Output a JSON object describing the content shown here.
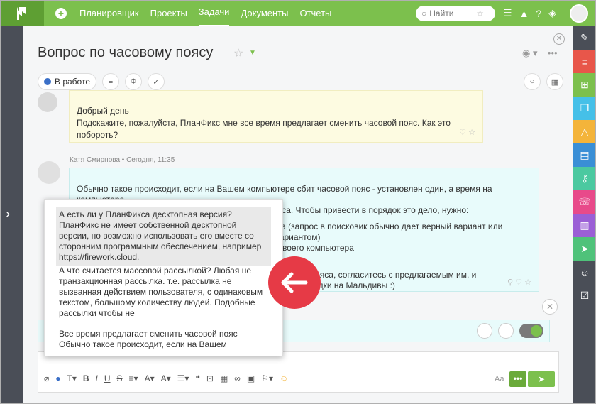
{
  "nav": [
    "Планировщик",
    "Проекты",
    "Задачи",
    "Документы",
    "Отчеты"
  ],
  "search": {
    "placeholder": "Найти"
  },
  "task": {
    "title": "Вопрос по часовому поясу",
    "status": "В работе"
  },
  "messages": {
    "first": {
      "line1": "Добрый день",
      "line2": "Подскажите, пожалуйста, ПланФикс мне все время предлагает сменить часовой пояс. Как это побороть?"
    },
    "second": {
      "author": "Катя Смирнова • Сегодня, 11:35",
      "lines": [
        "Обычно такое происходит, если на Вашем компьютере сбит часовой пояс - установлен один, а время на компьютере",
        "выставлено принудительно из другого часового пояса. Чтобы привести в порядок это дело, нужно:",
        "рода (запрос в поисковик обычно дает верный вариант или",
        "м вариантом)",
        "ах своего компьютера",
        ")",
        "т часового пояса, согласитесь с предлагаемым им, и",
        "жайшей поездки на Мальдивы :)"
      ]
    }
  },
  "popup": {
    "p1": "А есть ли у ПланФикса десктопная версия? ПланФикс не имеет собственной десктопной версии, но возможно использовать его вместе со сторонним программным обеспечением, например https://firework.cloud.",
    "p2": "А что считается массовой рассылкой? Любая не транзакционная рассылка. т.е. рассылка не вызванная действием пользователя, с одинаковым текстом, большому количеству людей. Подобные рассылки чтобы не",
    "p3": "Все время предлагает сменить часовой пояс Обычно такое происходит, если на Вашем"
  },
  "editor": {
    "aa": "Aa",
    "more": "•••"
  },
  "colors": {
    "brand": "#7cc04d",
    "red": "#e63a46",
    "sidebar": "#4a4e57"
  },
  "rightbar_colors": [
    "#4a4e57",
    "#e8564a",
    "#7cc04d",
    "#45c0e8",
    "#f4b43a",
    "#3a8fd6",
    "#4bc9a0",
    "#e84a8a",
    "#9b5fd6",
    "#4fc27a",
    "#4a4e57",
    "#4a4e57"
  ]
}
